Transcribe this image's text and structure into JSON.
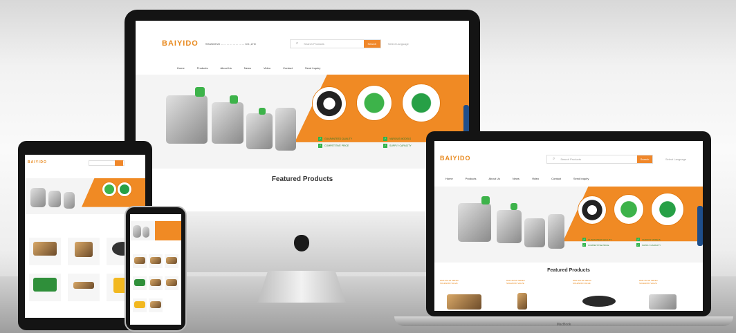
{
  "site": {
    "logo": "BAIYIDO",
    "company": "SHANGHAI ... ... ... ... ... ... ... ... CO.,LTD",
    "search_placeholder": "Search Products",
    "search_button": "Search",
    "lang": "Select Language",
    "nav": [
      "Home",
      "Products",
      "About Us",
      "News",
      "Video",
      "Contact",
      "Send Inquiry"
    ],
    "badges": [
      "GUARANTEED QUALITY",
      "VARIOUS MODELS",
      "COMPETITIVE PRICE",
      "SUPPLY CAPACITY"
    ],
    "featured": "Featured Products",
    "laptop_products": [
      "DMF-ZM-25 SBFEC SOLENOID VALVE",
      "DMF-ZM-25 SBFEC SOLENOID VALVE",
      "DMF-ZM-25 SBFEC SOLENOID VALVE",
      "DMF-ZM-25 SBFEC SOLENOID VALVE"
    ]
  },
  "laptop_brand": "MacBook",
  "colors": {
    "accent": "#f08a24",
    "badge": "#2fb34a",
    "sidebar": "#1e4e8a"
  }
}
